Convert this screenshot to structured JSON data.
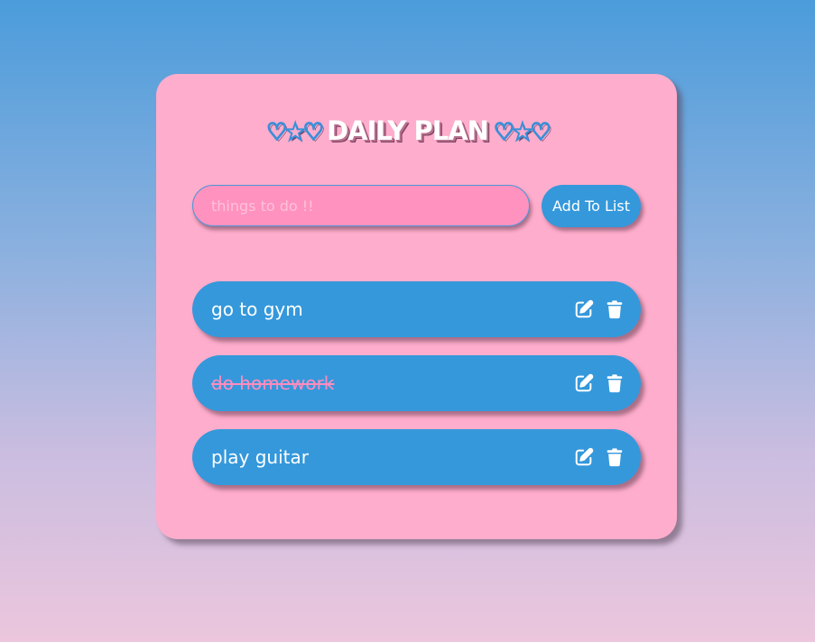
{
  "header": {
    "deco_left": "♡★♡",
    "title": "DAILY PLAN",
    "deco_right": "♡★♡"
  },
  "form": {
    "input_placeholder": "things to do !!",
    "input_value": "",
    "add_button_label": "Add To List"
  },
  "tasks": [
    {
      "label": "go to gym",
      "completed": false
    },
    {
      "label": "do homework",
      "completed": true
    },
    {
      "label": "play guitar",
      "completed": false
    }
  ],
  "icons": {
    "edit": "pen-to-square-icon",
    "delete": "trash-icon"
  },
  "colors": {
    "card_background": "#ffadcc",
    "accent_blue": "#3498db",
    "input_background": "#ff92bf",
    "completed_text": "#ff8cbd"
  }
}
